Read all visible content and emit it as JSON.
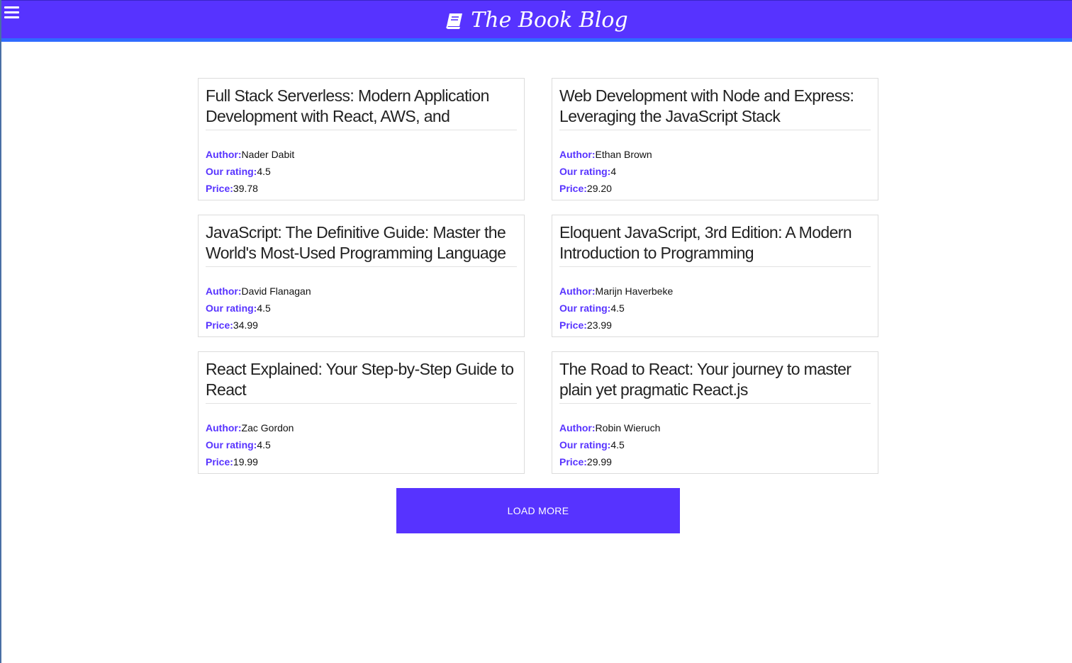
{
  "header": {
    "title": "The Book Blog",
    "brand_icon": "book-icon",
    "menu_icon": "hamburger-menu-icon"
  },
  "labels": {
    "author": "Author:",
    "rating": "Our rating:",
    "price": "Price:"
  },
  "books": [
    {
      "title": "Full Stack Serverless: Modern Application Development with React, AWS, and GraphQL",
      "author": "Nader Dabit",
      "rating": "4.5",
      "price": "39.78"
    },
    {
      "title": "Web Development with Node and Express: Leveraging the JavaScript Stack",
      "author": "Ethan Brown",
      "rating": "4",
      "price": "29.20"
    },
    {
      "title": "JavaScript: The Definitive Guide: Master the World's Most-Used Programming Language",
      "author": "David Flanagan",
      "rating": "4.5",
      "price": "34.99"
    },
    {
      "title": "Eloquent JavaScript, 3rd Edition: A Modern Introduction to Programming",
      "author": "Marijn Haverbeke",
      "rating": "4.5",
      "price": "23.99"
    },
    {
      "title": "React Explained: Your Step-by-Step Guide to React",
      "author": "Zac Gordon",
      "rating": "4.5",
      "price": "19.99"
    },
    {
      "title": "The Road to React: Your journey to master plain yet pragmatic React.js",
      "author": "Robin Wieruch",
      "rating": "4.5",
      "price": "29.99"
    }
  ],
  "load_more": {
    "label": "LOAD MORE"
  },
  "colors": {
    "accent": "#5733ff",
    "header_underline": "#2f6bff"
  }
}
